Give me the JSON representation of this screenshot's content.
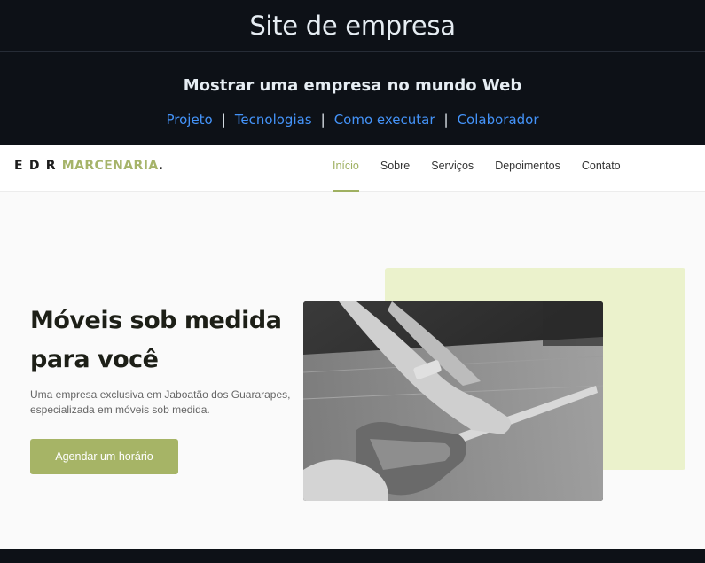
{
  "readme": {
    "title": "Site de empresa",
    "subtitle": "Mostrar uma empresa no mundo Web",
    "links": [
      {
        "label": "Projeto"
      },
      {
        "label": "Tecnologias"
      },
      {
        "label": "Como executar"
      },
      {
        "label": "Colaborador"
      }
    ],
    "separator": "|"
  },
  "site": {
    "logo": {
      "part1": "E D R ",
      "part2": "MARCENARIA",
      "part3": "."
    },
    "nav": [
      {
        "label": "Início",
        "active": true
      },
      {
        "label": "Sobre"
      },
      {
        "label": "Serviços"
      },
      {
        "label": "Depoimentos"
      },
      {
        "label": "Contato"
      }
    ],
    "hero": {
      "title": "Móveis sob medida para você",
      "text": "Uma empresa exclusiva em Jaboatão dos Guararapes, especializada em móveis sob medida.",
      "button": "Agendar um horário"
    }
  },
  "colors": {
    "accent": "#a6b466",
    "accent_light": "#ebf2cc",
    "link": "#4493f8",
    "background": "#0d1117"
  }
}
